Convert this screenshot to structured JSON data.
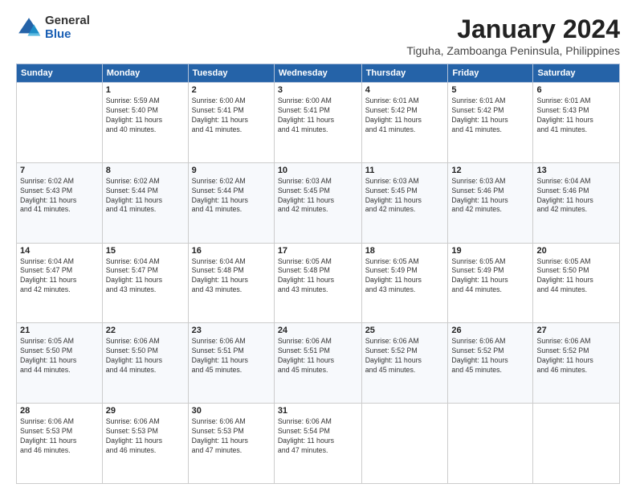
{
  "logo": {
    "general": "General",
    "blue": "Blue"
  },
  "title": "January 2024",
  "subtitle": "Tiguha, Zamboanga Peninsula, Philippines",
  "headers": [
    "Sunday",
    "Monday",
    "Tuesday",
    "Wednesday",
    "Thursday",
    "Friday",
    "Saturday"
  ],
  "weeks": [
    [
      {
        "day": "",
        "info": ""
      },
      {
        "day": "1",
        "info": "Sunrise: 5:59 AM\nSunset: 5:40 PM\nDaylight: 11 hours\nand 40 minutes."
      },
      {
        "day": "2",
        "info": "Sunrise: 6:00 AM\nSunset: 5:41 PM\nDaylight: 11 hours\nand 41 minutes."
      },
      {
        "day": "3",
        "info": "Sunrise: 6:00 AM\nSunset: 5:41 PM\nDaylight: 11 hours\nand 41 minutes."
      },
      {
        "day": "4",
        "info": "Sunrise: 6:01 AM\nSunset: 5:42 PM\nDaylight: 11 hours\nand 41 minutes."
      },
      {
        "day": "5",
        "info": "Sunrise: 6:01 AM\nSunset: 5:42 PM\nDaylight: 11 hours\nand 41 minutes."
      },
      {
        "day": "6",
        "info": "Sunrise: 6:01 AM\nSunset: 5:43 PM\nDaylight: 11 hours\nand 41 minutes."
      }
    ],
    [
      {
        "day": "7",
        "info": "Sunrise: 6:02 AM\nSunset: 5:43 PM\nDaylight: 11 hours\nand 41 minutes."
      },
      {
        "day": "8",
        "info": "Sunrise: 6:02 AM\nSunset: 5:44 PM\nDaylight: 11 hours\nand 41 minutes."
      },
      {
        "day": "9",
        "info": "Sunrise: 6:02 AM\nSunset: 5:44 PM\nDaylight: 11 hours\nand 41 minutes."
      },
      {
        "day": "10",
        "info": "Sunrise: 6:03 AM\nSunset: 5:45 PM\nDaylight: 11 hours\nand 42 minutes."
      },
      {
        "day": "11",
        "info": "Sunrise: 6:03 AM\nSunset: 5:45 PM\nDaylight: 11 hours\nand 42 minutes."
      },
      {
        "day": "12",
        "info": "Sunrise: 6:03 AM\nSunset: 5:46 PM\nDaylight: 11 hours\nand 42 minutes."
      },
      {
        "day": "13",
        "info": "Sunrise: 6:04 AM\nSunset: 5:46 PM\nDaylight: 11 hours\nand 42 minutes."
      }
    ],
    [
      {
        "day": "14",
        "info": "Sunrise: 6:04 AM\nSunset: 5:47 PM\nDaylight: 11 hours\nand 42 minutes."
      },
      {
        "day": "15",
        "info": "Sunrise: 6:04 AM\nSunset: 5:47 PM\nDaylight: 11 hours\nand 43 minutes."
      },
      {
        "day": "16",
        "info": "Sunrise: 6:04 AM\nSunset: 5:48 PM\nDaylight: 11 hours\nand 43 minutes."
      },
      {
        "day": "17",
        "info": "Sunrise: 6:05 AM\nSunset: 5:48 PM\nDaylight: 11 hours\nand 43 minutes."
      },
      {
        "day": "18",
        "info": "Sunrise: 6:05 AM\nSunset: 5:49 PM\nDaylight: 11 hours\nand 43 minutes."
      },
      {
        "day": "19",
        "info": "Sunrise: 6:05 AM\nSunset: 5:49 PM\nDaylight: 11 hours\nand 44 minutes."
      },
      {
        "day": "20",
        "info": "Sunrise: 6:05 AM\nSunset: 5:50 PM\nDaylight: 11 hours\nand 44 minutes."
      }
    ],
    [
      {
        "day": "21",
        "info": "Sunrise: 6:05 AM\nSunset: 5:50 PM\nDaylight: 11 hours\nand 44 minutes."
      },
      {
        "day": "22",
        "info": "Sunrise: 6:06 AM\nSunset: 5:50 PM\nDaylight: 11 hours\nand 44 minutes."
      },
      {
        "day": "23",
        "info": "Sunrise: 6:06 AM\nSunset: 5:51 PM\nDaylight: 11 hours\nand 45 minutes."
      },
      {
        "day": "24",
        "info": "Sunrise: 6:06 AM\nSunset: 5:51 PM\nDaylight: 11 hours\nand 45 minutes."
      },
      {
        "day": "25",
        "info": "Sunrise: 6:06 AM\nSunset: 5:52 PM\nDaylight: 11 hours\nand 45 minutes."
      },
      {
        "day": "26",
        "info": "Sunrise: 6:06 AM\nSunset: 5:52 PM\nDaylight: 11 hours\nand 45 minutes."
      },
      {
        "day": "27",
        "info": "Sunrise: 6:06 AM\nSunset: 5:52 PM\nDaylight: 11 hours\nand 46 minutes."
      }
    ],
    [
      {
        "day": "28",
        "info": "Sunrise: 6:06 AM\nSunset: 5:53 PM\nDaylight: 11 hours\nand 46 minutes."
      },
      {
        "day": "29",
        "info": "Sunrise: 6:06 AM\nSunset: 5:53 PM\nDaylight: 11 hours\nand 46 minutes."
      },
      {
        "day": "30",
        "info": "Sunrise: 6:06 AM\nSunset: 5:53 PM\nDaylight: 11 hours\nand 47 minutes."
      },
      {
        "day": "31",
        "info": "Sunrise: 6:06 AM\nSunset: 5:54 PM\nDaylight: 11 hours\nand 47 minutes."
      },
      {
        "day": "",
        "info": ""
      },
      {
        "day": "",
        "info": ""
      },
      {
        "day": "",
        "info": ""
      }
    ]
  ]
}
